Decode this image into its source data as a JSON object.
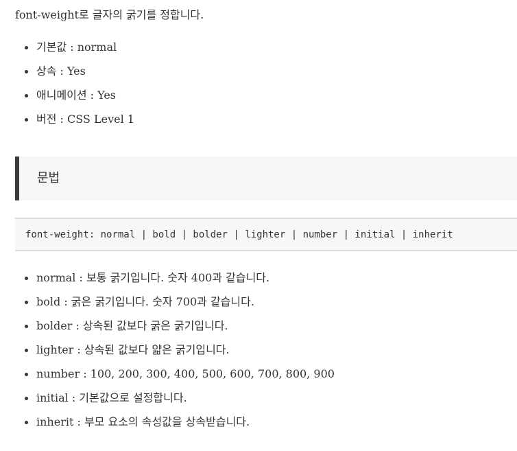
{
  "intro": "font-weight로 글자의 굵기를 정합니다.",
  "properties": [
    "기본값 : normal",
    "상속 : Yes",
    "애니메이션 : Yes",
    "버전 : CSS Level 1"
  ],
  "syntax_heading": "문법",
  "syntax_code": "font-weight: normal | bold | bolder | lighter | number | initial | inherit",
  "values": [
    "normal : 보통 굵기입니다. 숫자 400과 같습니다.",
    "bold : 굵은 굵기입니다. 숫자 700과 같습니다.",
    "bolder : 상속된 값보다 굵은 굵기입니다.",
    "lighter : 상속된 값보다 얇은 굵기입니다.",
    "number : 100, 200, 300, 400, 500, 600, 700, 800, 900",
    "initial : 기본값으로 설정합니다.",
    "inherit : 부모 요소의 속성값을 상속받습니다."
  ]
}
